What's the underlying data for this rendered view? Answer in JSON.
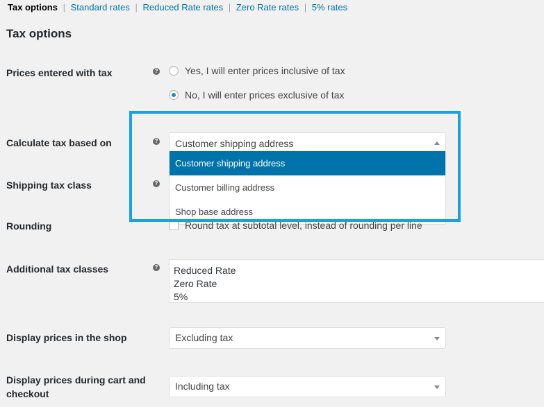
{
  "subnav": {
    "current": "Tax options",
    "links": [
      "Standard rates",
      "Reduced Rate rates",
      "Zero Rate rates",
      "5% rates"
    ],
    "separator": "|"
  },
  "section_title": "Tax options",
  "help_glyph": "?",
  "prices_entered": {
    "label": "Prices entered with tax",
    "options": [
      {
        "label": "Yes, I will enter prices inclusive of tax",
        "checked": false
      },
      {
        "label": "No, I will enter prices exclusive of tax",
        "checked": true
      }
    ]
  },
  "calculate_based_on": {
    "label": "Calculate tax based on",
    "value": "Customer shipping address",
    "options": [
      "Customer shipping address",
      "Customer billing address",
      "Shop base address"
    ],
    "highlighted_option": "Customer shipping address",
    "dropdown_open": true
  },
  "shipping_tax_class": {
    "label": "Shipping tax class"
  },
  "rounding": {
    "label": "Rounding",
    "checkbox_label": "Round tax at subtotal level, instead of rounding per line",
    "checked": false
  },
  "additional_tax_classes": {
    "label": "Additional tax classes",
    "lines": [
      "Reduced Rate",
      "Zero Rate",
      "5%"
    ]
  },
  "display_prices_shop": {
    "label": "Display prices in the shop",
    "value": "Excluding tax"
  },
  "display_prices_cart": {
    "label_line1": "Display prices during cart and",
    "label_line2": "checkout",
    "value": "Including tax"
  },
  "colors": {
    "link": "#0073aa",
    "selected_option_bg": "#0073aa",
    "highlight_border": "#1ba1e2",
    "page_bg": "#f1f1f1"
  }
}
